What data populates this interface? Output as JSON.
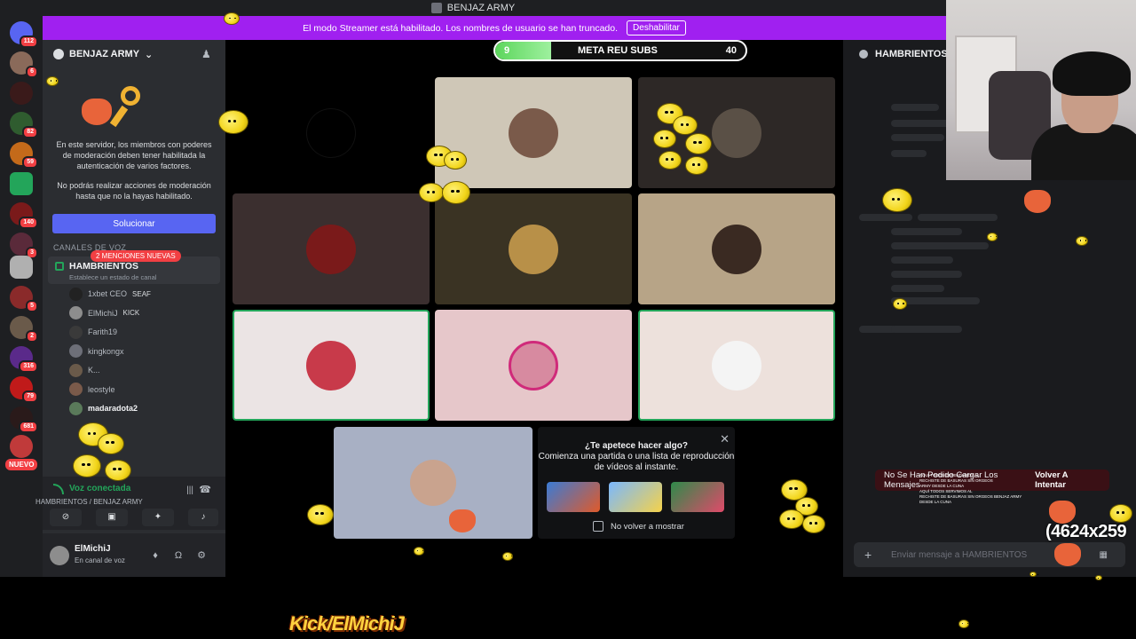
{
  "window": {
    "title": "BENJAZ ARMY"
  },
  "rail": {
    "badges": [
      "112",
      "6",
      "82",
      "59",
      "140",
      "3",
      "5",
      "2",
      "316",
      "79",
      "681"
    ],
    "nuevo": "NUEVO"
  },
  "banner": {
    "text": "El modo Streamer está habilitado. Los nombres de usuario se han truncado.",
    "button": "Deshabilitar"
  },
  "server": {
    "name": "BENJAZ ARMY",
    "notice_1": "En este servidor, los miembros con poderes de moderación deben tener habilitada la autenticación de varios factores.",
    "notice_2": "No podrás realizar acciones de moderación hasta que no la hayas habilitado.",
    "solve_button": "Solucionar",
    "category": "CANALES DE VOZ",
    "mentions": "2 MENCIONES NUEVAS",
    "channel": {
      "name": "HAMBRIENTOS",
      "status": "Establece un estado de canal"
    },
    "members": [
      {
        "name": "1xbet CEO",
        "tag": "SEAF",
        "bold": false
      },
      {
        "name": "ElMichiJ",
        "tag": "KICK",
        "bold": false
      },
      {
        "name": "Farith19",
        "tag": "",
        "bold": false
      },
      {
        "name": "kingkongx",
        "tag": "",
        "bold": false
      },
      {
        "name": "K...",
        "tag": "",
        "bold": false
      },
      {
        "name": "leostyle",
        "tag": "",
        "bold": false
      },
      {
        "name": "madaradota2",
        "tag": "",
        "bold": true
      }
    ]
  },
  "voice": {
    "title": "Voz conectada",
    "subtitle": "HAMBRIENTOS / BENJAZ ARMY"
  },
  "user": {
    "name": "ElMichiJ",
    "status": "En canal de voz"
  },
  "stage": {
    "meta": {
      "label": "META REU SUBS",
      "current": "9",
      "goal": "40",
      "progress": 0.225
    },
    "suggestion": {
      "title": "¿Te apetece hacer algo?",
      "body": "Comienza una partida o una lista de reproducción de vídeos al instante.",
      "checkbox": "No volver a mostrar"
    }
  },
  "rightpanel": {
    "channel": "HAMBRIENTOS",
    "error": "No Se Han Podido Cargar Los Mensajes",
    "retry": "Volver A Intentar",
    "placeholder": "Enviar mensaje a HAMBRIENTOS"
  },
  "overlay": {
    "counter": "(4624x259",
    "kick": "Kick/ElMichiJ",
    "chat": [
      "AQUÍ TODOS DEFENDEMOS AL",
      "RECHISTE DE BASURAS SIN ORGEOS",
      "ARMY DESDE LA CUNA",
      "AQUÍ TODOS SERVIMOS AL",
      "RECHISTE DE BASURAS SIN ORGEOS BENJAZ ARMY",
      "DESDE LA CUNA"
    ]
  },
  "colors": {
    "accent": "#5865f2",
    "banner": "#a020f0",
    "speaking": "#23a55a",
    "danger": "#f23f43"
  }
}
